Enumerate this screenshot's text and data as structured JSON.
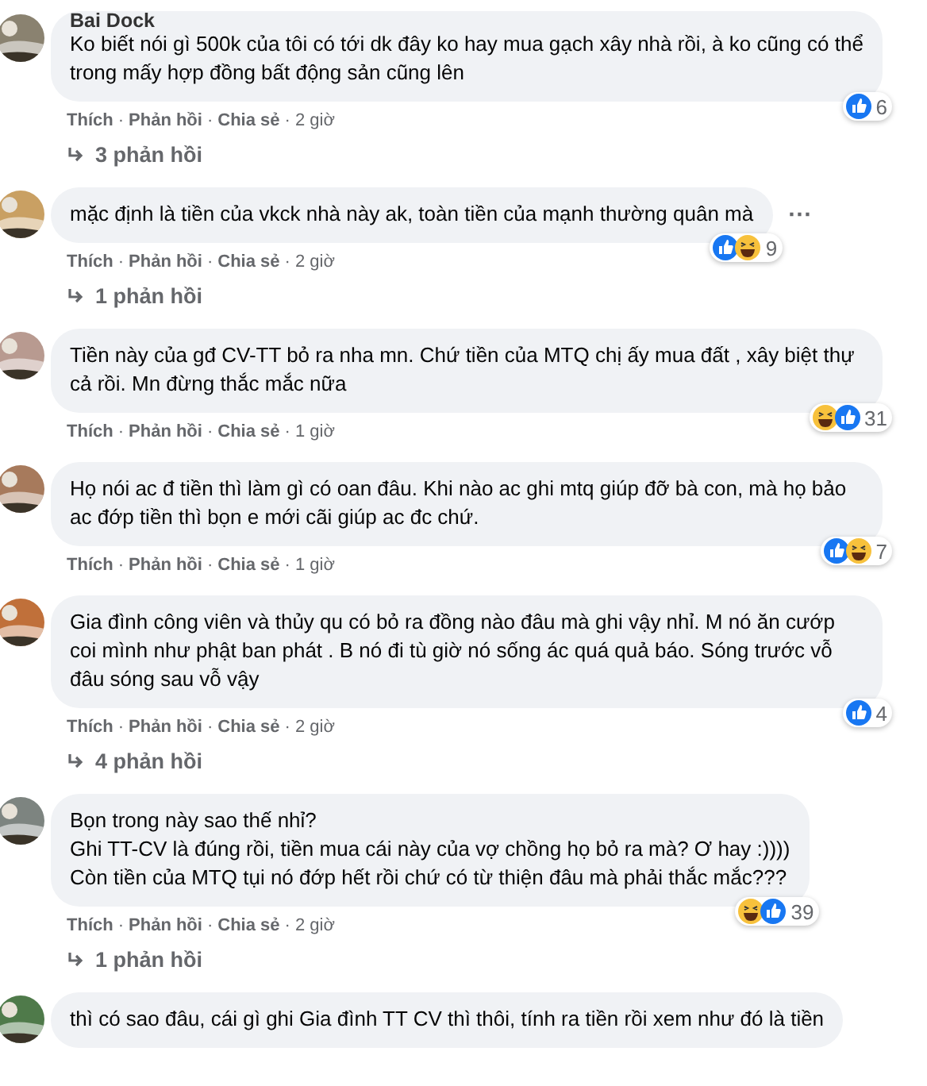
{
  "comments": [
    {
      "name": "Bai Dock",
      "text": "Ko biết nói gì 500k của tôi có tới dk đây ko hay mua gạch xây nhà rồi, à ko cũng có thể trong mấy hợp đồng bất động sản cũng lên",
      "reactions": [
        {
          "kind": "like"
        }
      ],
      "reaction_count": "6",
      "actions": [
        "Thích",
        "Phản hồi",
        "Chia sẻ"
      ],
      "separator": "·",
      "time": "2 giờ",
      "replies": "3 phản hồi"
    },
    {
      "text": "mặc định là tiền của vkck nhà này ak, toàn tiền của mạnh thường quân mà",
      "reactions": [
        {
          "kind": "like"
        },
        {
          "kind": "haha"
        }
      ],
      "reaction_count": "9",
      "actions": [
        "Thích",
        "Phản hồi",
        "Chia sẻ"
      ],
      "separator": "·",
      "time": "2 giờ",
      "replies": "1 phản hồi",
      "more_symbol": "···"
    },
    {
      "text": "Tiền này của gđ CV-TT bỏ ra nha mn. Chứ tiền của MTQ chị ấy mua đất , xây biệt thự cả rồi. Mn đừng thắc mắc nữa",
      "reactions": [
        {
          "kind": "haha"
        },
        {
          "kind": "like"
        }
      ],
      "reaction_count": "31",
      "actions": [
        "Thích",
        "Phản hồi",
        "Chia sẻ"
      ],
      "separator": "·",
      "time": "1 giờ"
    },
    {
      "text": "Họ nói ac đ tiền thì làm gì có oan đâu. Khi nào ac ghi mtq giúp đỡ bà con, mà họ bảo ac đớp tiền thì bọn e mới cãi giúp ac đc chứ.",
      "reactions": [
        {
          "kind": "like"
        },
        {
          "kind": "haha"
        }
      ],
      "reaction_count": "7",
      "actions": [
        "Thích",
        "Phản hồi",
        "Chia sẻ"
      ],
      "separator": "·",
      "time": "1 giờ"
    },
    {
      "text": "Gia đình công viên và thủy qu có bỏ ra đồng nào đâu mà ghi vậy nhỉ. M nó ăn cướp coi mình như phật ban phát . B nó đi tù giờ nó sống ác quá quả báo. Sóng trước vỗ đâu sóng sau vỗ vậy",
      "reactions": [
        {
          "kind": "like"
        }
      ],
      "reaction_count": "4",
      "actions": [
        "Thích",
        "Phản hồi",
        "Chia sẻ"
      ],
      "separator": "·",
      "time": "2 giờ",
      "replies": "4 phản hồi"
    },
    {
      "text": "Bọn trong này sao thế nhỉ?\nGhi TT-CV là đúng rồi, tiền mua cái này của vợ chồng họ bỏ ra mà? Ơ hay :))))\nCòn tiền của MTQ tụi nó đớp hết rồi chứ có từ thiện đâu mà phải thắc mắc???",
      "reactions": [
        {
          "kind": "haha"
        },
        {
          "kind": "like"
        }
      ],
      "reaction_count": "39",
      "actions": [
        "Thích",
        "Phản hồi",
        "Chia sẻ"
      ],
      "separator": "·",
      "time": "2 giờ",
      "replies": "1 phản hồi"
    },
    {
      "text": "thì có sao đâu, cái gì ghi Gia đình TT CV thì thôi, tính ra tiền rồi xem như đó là tiền"
    }
  ]
}
